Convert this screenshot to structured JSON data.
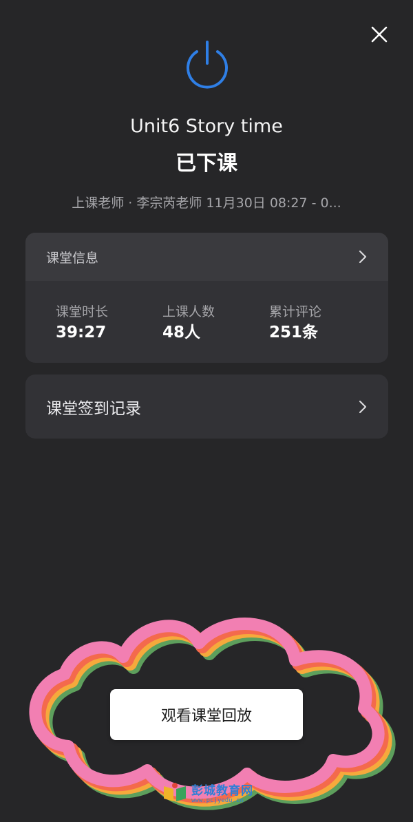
{
  "header": {
    "close_icon": "close-icon",
    "power_icon": "power-icon",
    "accent_color": "#2f7fe6"
  },
  "lesson": {
    "title": "Unit6 Story time",
    "status": "已下课",
    "meta": "上课老师 · 李宗芮老师  11月30日 08:27 - 0..."
  },
  "class_info": {
    "title": "课堂信息",
    "stats": [
      {
        "label": "课堂时长",
        "value": "39:27"
      },
      {
        "label": "上课人数",
        "value": "48人"
      },
      {
        "label": "累计评论",
        "value": "251条"
      }
    ]
  },
  "signin": {
    "label": "课堂签到记录"
  },
  "replay_button": {
    "label": "观看课堂回放"
  },
  "watermark": {
    "name": "彭城教育网",
    "url": "www.pcjyedu.cn"
  },
  "decoration_colors": [
    "#f27fb2",
    "#f46a4c",
    "#f6a93c",
    "#5d9f5c"
  ]
}
